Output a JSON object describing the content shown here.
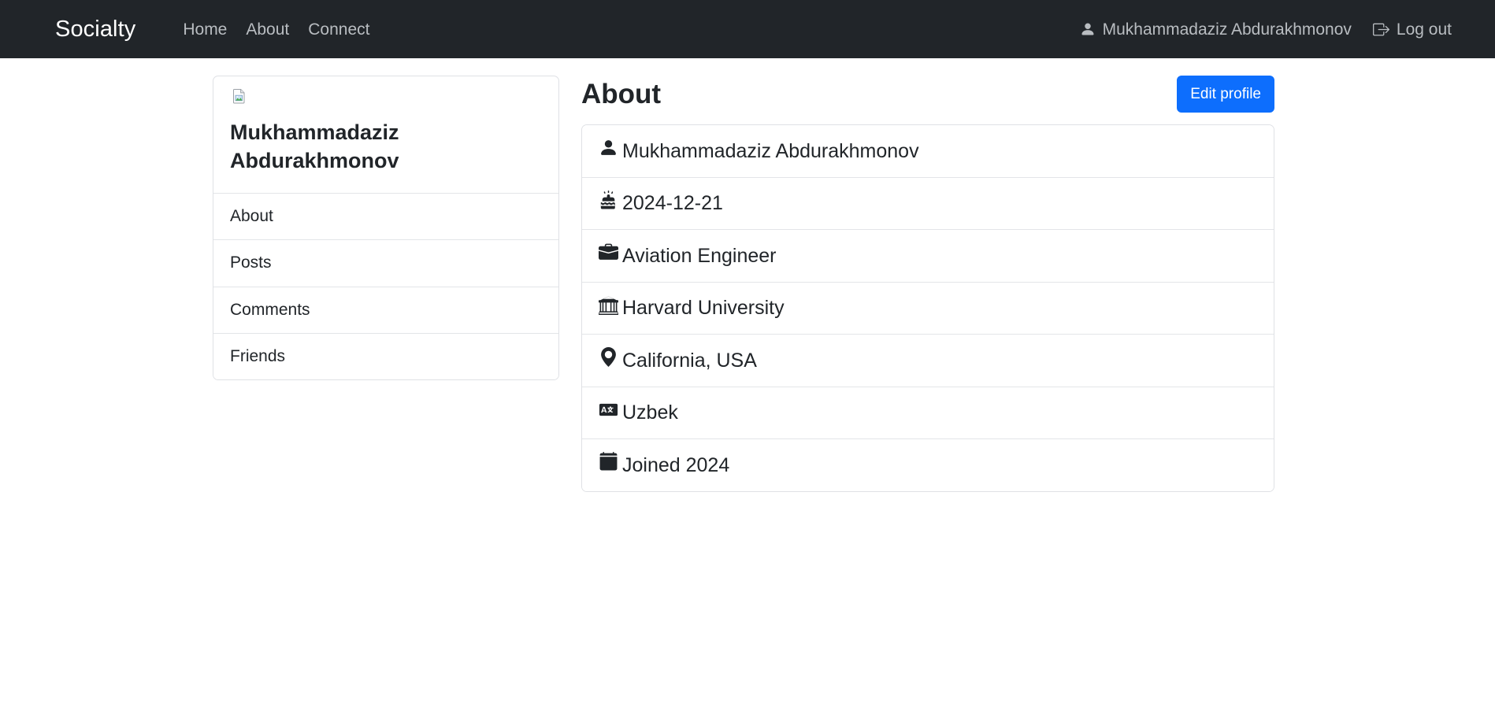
{
  "navbar": {
    "brand": "Socialty",
    "links": [
      {
        "label": "Home",
        "name": "nav-link-home"
      },
      {
        "label": "About",
        "name": "nav-link-about"
      },
      {
        "label": "Connect",
        "name": "nav-link-connect"
      }
    ],
    "user_icon": "person-fill-icon",
    "user_name": "Mukhammadaziz Abdurakhmonov",
    "logout_icon": "box-arrow-right-icon",
    "logout_label": "Log out",
    "background_color": "#212529",
    "brand_color": "#ffffff",
    "link_color": "#b9bdc1"
  },
  "sidebar": {
    "avatar_icon": "broken-image-icon",
    "profile_name": "Mukhammadaziz Abdurakhmonov",
    "items": [
      {
        "label": "About",
        "name": "sidebar-item-about"
      },
      {
        "label": "Posts",
        "name": "sidebar-item-posts"
      },
      {
        "label": "Comments",
        "name": "sidebar-item-comments"
      },
      {
        "label": "Friends",
        "name": "sidebar-item-friends"
      }
    ]
  },
  "main": {
    "title": "About",
    "edit_button_label": "Edit profile",
    "accent_color": "#0d6efd",
    "details": [
      {
        "icon": "person-fill-icon",
        "value": "Mukhammadaziz Abdurakhmonov",
        "name": "detail-full-name"
      },
      {
        "icon": "cake-icon",
        "value": "2024-12-21",
        "name": "detail-birthday"
      },
      {
        "icon": "briefcase-fill-icon",
        "value": "Aviation Engineer",
        "name": "detail-occupation"
      },
      {
        "icon": "bank-icon",
        "value": "Harvard University",
        "name": "detail-education"
      },
      {
        "icon": "geo-alt-fill-icon",
        "value": "California, USA",
        "name": "detail-location"
      },
      {
        "icon": "translate-icon",
        "value": "Uzbek",
        "name": "detail-language"
      },
      {
        "icon": "calendar-fill-icon",
        "value": "Joined 2024",
        "name": "detail-joined"
      }
    ]
  }
}
